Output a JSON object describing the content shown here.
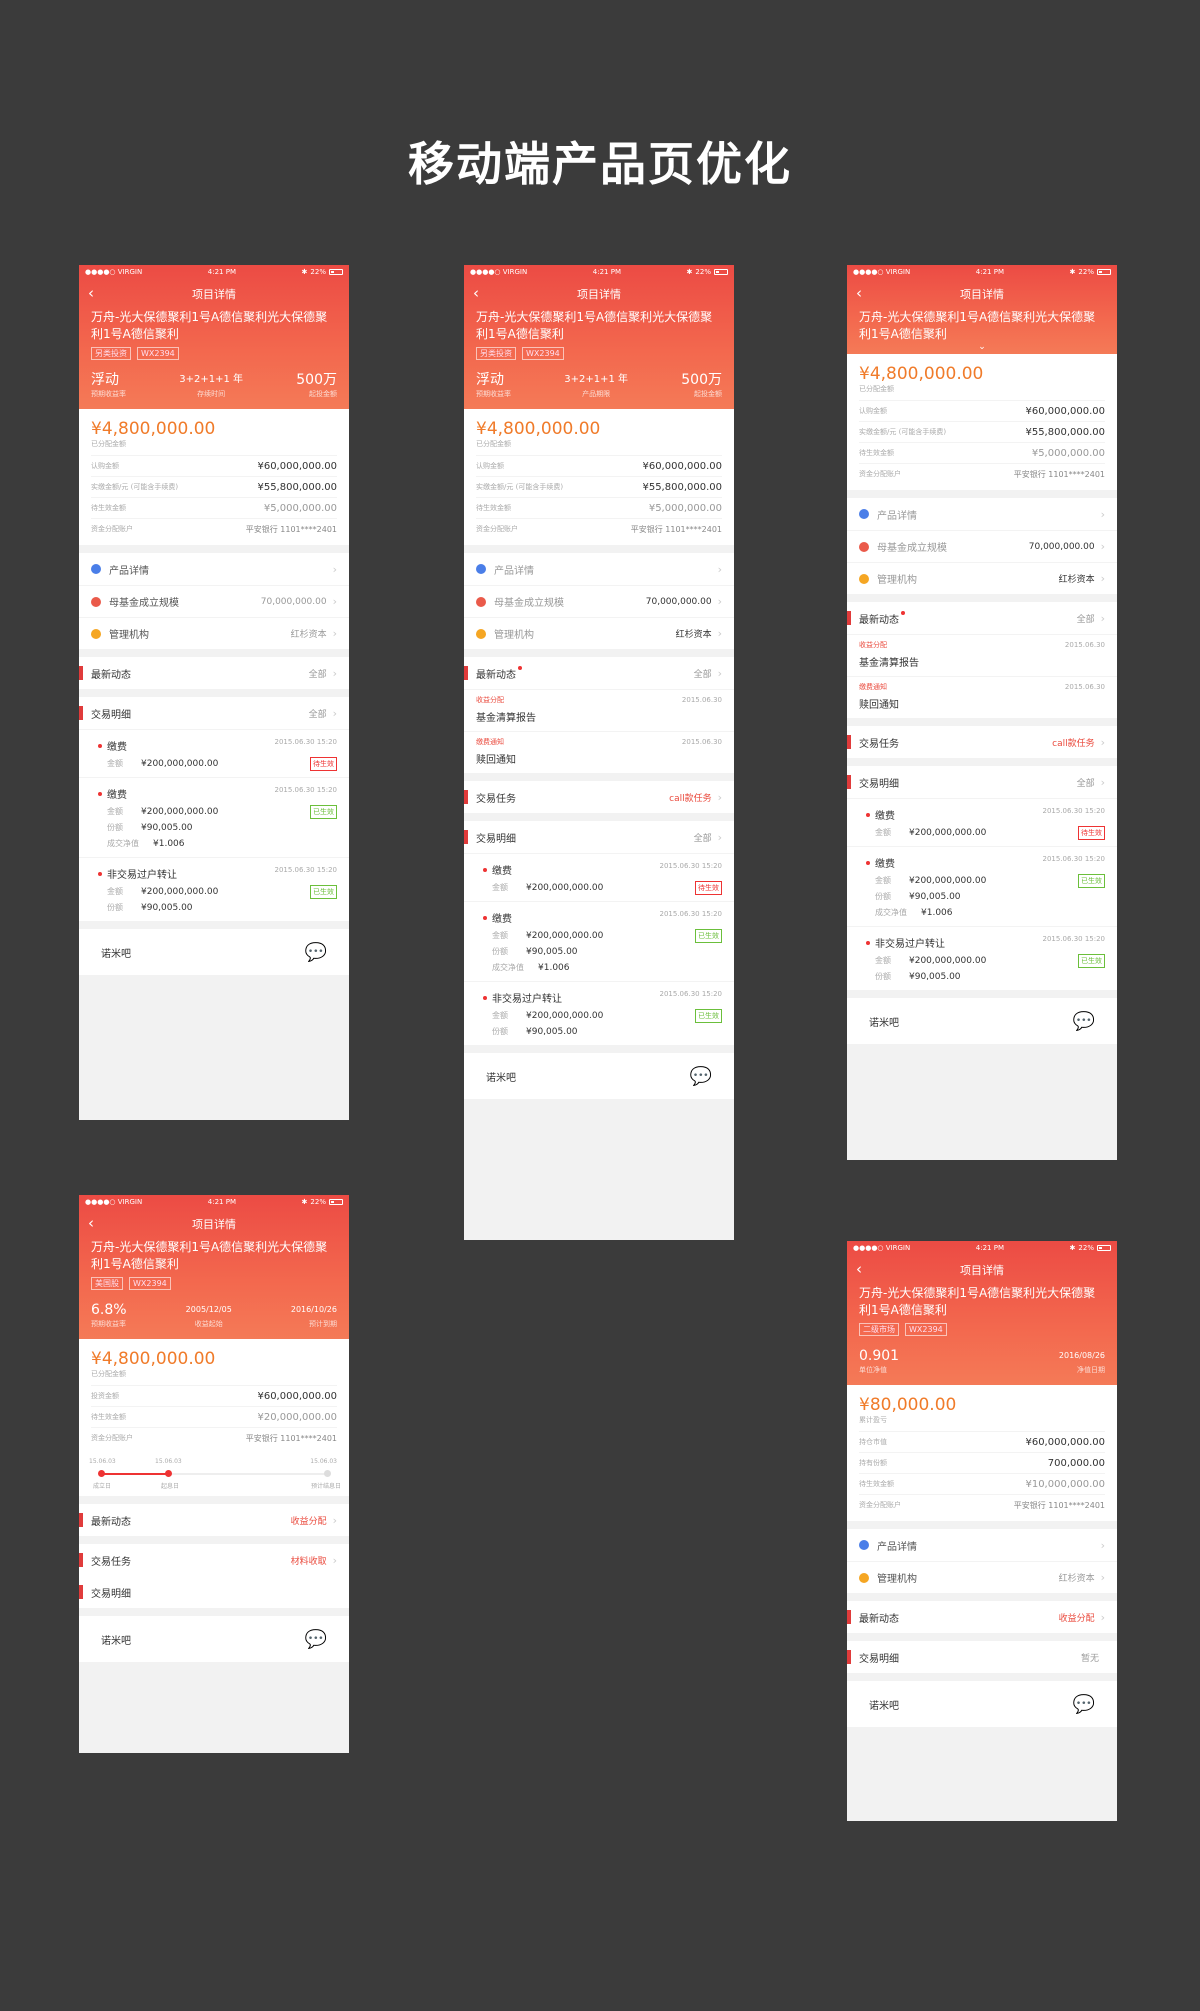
{
  "page_title": "移动端产品页优化",
  "status": {
    "carrier": "VIRGIN",
    "time": "4:21 PM",
    "battery": "22%"
  },
  "nav_title": "项目详情",
  "product": {
    "title_a": "万舟-光大保德聚利1号A德信聚利光大保德聚利1号A德信聚利",
    "tag1": "另类投资",
    "tag2": "WX2394"
  },
  "stats": {
    "yield": "浮动",
    "yield_label": "预期收益率",
    "term": "3+2+1+1 年",
    "term_label": "存续时间",
    "term_label2": "产品期限",
    "min": "500万",
    "min_label": "起投金额"
  },
  "money": {
    "allocated": "¥4,800,000.00",
    "allocated_label": "已分配金额",
    "subscribe_label": "认购金额",
    "subscribe": "¥60,000,000.00",
    "paid_label": "实缴金额/元 (可能含手续费)",
    "paid": "¥55,800,000.00",
    "pending_label": "待生效金额",
    "pending": "¥5,000,000.00",
    "account_label": "资金分配账户",
    "account": "平安银行 1101****2401"
  },
  "menu": {
    "product_detail": "产品详情",
    "fund_size_label": "母基金成立规模",
    "fund_size": "70,000,000.00",
    "manager_label": "管理机构",
    "manager": "红杉资本"
  },
  "sections": {
    "news": "最新动态",
    "all": "全部",
    "tasks": "交易任务",
    "call_task": "call款任务",
    "detail": "交易明细",
    "news1_type": "收益分配",
    "news1_title": "基金清算报告",
    "news_date": "2015.06.30",
    "news2_type": "缴费通知",
    "news2_title": "赎回通知"
  },
  "tx": {
    "pay": "缴费",
    "transfer": "非交易过户转让",
    "date": "2015.06.30  15:20",
    "amt_label": "金额",
    "amt": "¥200,000,000.00",
    "shares_label": "份额",
    "shares": "¥90,005.00",
    "nav_label": "成交净值",
    "nav": "¥1.006",
    "pending": "待生效",
    "done": "已生效"
  },
  "footer": {
    "label": "诺米吧"
  },
  "phone4": {
    "tag1": "美国股",
    "yield": "6.8%",
    "yield_label": "预期收益率",
    "start": "2005/12/05",
    "start_label": "收益起始",
    "end": "2016/10/26",
    "end_label": "预计到期",
    "invest_label": "投资金额",
    "invest": "¥60,000,000.00",
    "pending": "¥20,000,000.00",
    "tl_d1": "15.06.03",
    "tl_d2": "15.06.03",
    "tl_d3": "15.06.03",
    "tl_l1": "成立日",
    "tl_l2": "起息日",
    "tl_l3": "预计结息日",
    "news_val": "收益分配",
    "task_val": "材料收取"
  },
  "phone5": {
    "tag1": "二级市场",
    "nav": "0.901",
    "nav_label": "单位净值",
    "date": "2016/08/26",
    "date_label": "净值日期",
    "amt": "¥80,000.00",
    "amt_label": "累计盈亏",
    "mv_label": "持仓市值",
    "mv": "¥60,000,000.00",
    "shares_label": "持有份额",
    "shares": "700,000.00",
    "pending": "¥10,000,000.00",
    "news_val": "收益分配",
    "detail_val": "暂无"
  }
}
